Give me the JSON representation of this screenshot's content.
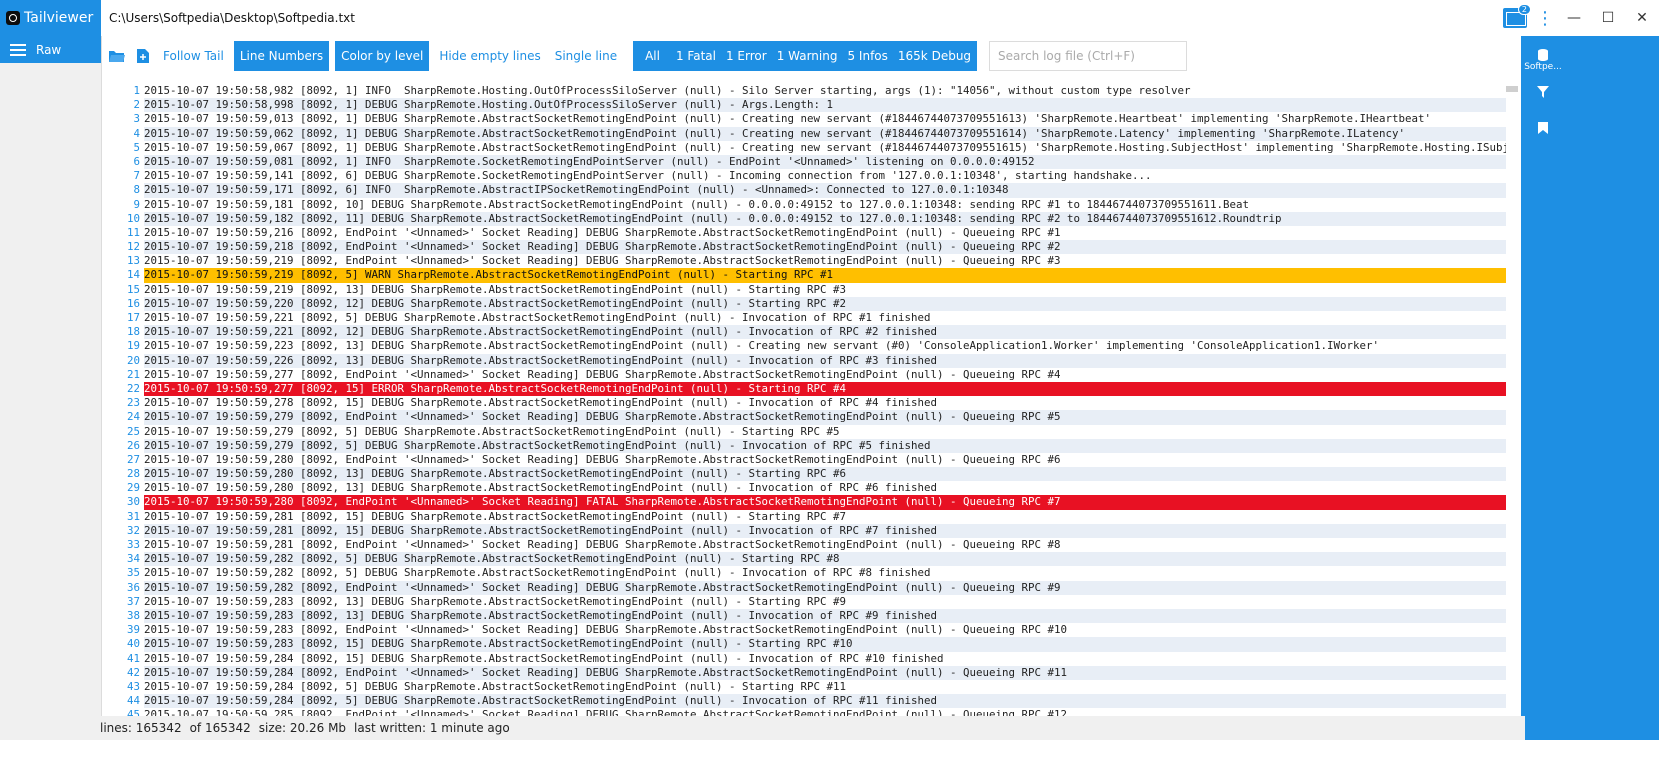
{
  "app": {
    "name": "Tailviewer",
    "file_path": "C:\\Users\\Softpedia\\Desktop\\Softpedia.txt",
    "notification_count": "2"
  },
  "sidebar": {
    "raw_label": "Raw"
  },
  "toolbar": {
    "follow_tail": "Follow Tail",
    "line_numbers": "Line Numbers",
    "color_by_level": "Color by level",
    "hide_empty_lines": "Hide empty lines",
    "single_line": "Single line",
    "levels": {
      "all": "All",
      "fatal": "1 Fatal",
      "error": "1 Error",
      "warning": "1 Warning",
      "infos": "5 Infos",
      "debug": "165k Debug"
    },
    "search_placeholder": "Search log file (Ctrl+F)"
  },
  "right_panel": {
    "datasource_label": "Softpe..."
  },
  "log_lines": [
    {
      "n": "1",
      "text": "2015-10-07 19:50:58,982 [8092, 1] INFO  SharpRemote.Hosting.OutOfProcessSiloServer (null) - Silo Server starting, args (1): \"14056\", without custom type resolver",
      "level": "info"
    },
    {
      "n": "2",
      "text": "2015-10-07 19:50:58,998 [8092, 1] DEBUG SharpRemote.Hosting.OutOfProcessSiloServer (null) - Args.Length: 1",
      "level": "debug"
    },
    {
      "n": "3",
      "text": "2015-10-07 19:50:59,013 [8092, 1] DEBUG SharpRemote.AbstractSocketRemotingEndPoint (null) - Creating new servant (#18446744073709551613) 'SharpRemote.Heartbeat' implementing 'SharpRemote.IHeartbeat'",
      "level": "debug"
    },
    {
      "n": "4",
      "text": "2015-10-07 19:50:59,062 [8092, 1] DEBUG SharpRemote.AbstractSocketRemotingEndPoint (null) - Creating new servant (#18446744073709551614) 'SharpRemote.Latency' implementing 'SharpRemote.ILatency'",
      "level": "debug"
    },
    {
      "n": "5",
      "text": "2015-10-07 19:50:59,067 [8092, 1] DEBUG SharpRemote.AbstractSocketRemotingEndPoint (null) - Creating new servant (#18446744073709551615) 'SharpRemote.Hosting.SubjectHost' implementing 'SharpRemote.Hosting.ISubjectHost'",
      "level": "debug"
    },
    {
      "n": "6",
      "text": "2015-10-07 19:50:59,081 [8092, 1] INFO  SharpRemote.SocketRemotingEndPointServer (null) - EndPoint '<Unnamed>' listening on 0.0.0.0:49152",
      "level": "info"
    },
    {
      "n": "7",
      "text": "2015-10-07 19:50:59,141 [8092, 6] DEBUG SharpRemote.SocketRemotingEndPointServer (null) - Incoming connection from '127.0.0.1:10348', starting handshake...",
      "level": "debug"
    },
    {
      "n": "8",
      "text": "2015-10-07 19:50:59,171 [8092, 6] INFO  SharpRemote.AbstractIPSocketRemotingEndPoint (null) - <Unnamed>: Connected to 127.0.0.1:10348",
      "level": "info"
    },
    {
      "n": "9",
      "text": "2015-10-07 19:50:59,181 [8092, 10] DEBUG SharpRemote.AbstractSocketRemotingEndPoint (null) - 0.0.0.0:49152 to 127.0.0.1:10348: sending RPC #1 to 18446744073709551611.Beat",
      "level": "debug"
    },
    {
      "n": "10",
      "text": "2015-10-07 19:50:59,182 [8092, 11] DEBUG SharpRemote.AbstractSocketRemotingEndPoint (null) - 0.0.0.0:49152 to 127.0.0.1:10348: sending RPC #2 to 18446744073709551612.Roundtrip",
      "level": "debug"
    },
    {
      "n": "11",
      "text": "2015-10-07 19:50:59,216 [8092, EndPoint '<Unnamed>' Socket Reading] DEBUG SharpRemote.AbstractSocketRemotingEndPoint (null) - Queueing RPC #1",
      "level": "debug"
    },
    {
      "n": "12",
      "text": "2015-10-07 19:50:59,218 [8092, EndPoint '<Unnamed>' Socket Reading] DEBUG SharpRemote.AbstractSocketRemotingEndPoint (null) - Queueing RPC #2",
      "level": "debug"
    },
    {
      "n": "13",
      "text": "2015-10-07 19:50:59,219 [8092, EndPoint '<Unnamed>' Socket Reading] DEBUG SharpRemote.AbstractSocketRemotingEndPoint (null) - Queueing RPC #3",
      "level": "debug"
    },
    {
      "n": "14",
      "text": "2015-10-07 19:50:59,219 [8092, 5] WARN SharpRemote.AbstractSocketRemotingEndPoint (null) - Starting RPC #1",
      "level": "warn"
    },
    {
      "n": "15",
      "text": "2015-10-07 19:50:59,219 [8092, 13] DEBUG SharpRemote.AbstractSocketRemotingEndPoint (null) - Starting RPC #3",
      "level": "debug"
    },
    {
      "n": "16",
      "text": "2015-10-07 19:50:59,220 [8092, 12] DEBUG SharpRemote.AbstractSocketRemotingEndPoint (null) - Starting RPC #2",
      "level": "debug"
    },
    {
      "n": "17",
      "text": "2015-10-07 19:50:59,221 [8092, 5] DEBUG SharpRemote.AbstractSocketRemotingEndPoint (null) - Invocation of RPC #1 finished",
      "level": "debug"
    },
    {
      "n": "18",
      "text": "2015-10-07 19:50:59,221 [8092, 12] DEBUG SharpRemote.AbstractSocketRemotingEndPoint (null) - Invocation of RPC #2 finished",
      "level": "debug"
    },
    {
      "n": "19",
      "text": "2015-10-07 19:50:59,223 [8092, 13] DEBUG SharpRemote.AbstractSocketRemotingEndPoint (null) - Creating new servant (#0) 'ConsoleApplication1.Worker' implementing 'ConsoleApplication1.IWorker'",
      "level": "debug"
    },
    {
      "n": "20",
      "text": "2015-10-07 19:50:59,226 [8092, 13] DEBUG SharpRemote.AbstractSocketRemotingEndPoint (null) - Invocation of RPC #3 finished",
      "level": "debug"
    },
    {
      "n": "21",
      "text": "2015-10-07 19:50:59,277 [8092, EndPoint '<Unnamed>' Socket Reading] DEBUG SharpRemote.AbstractSocketRemotingEndPoint (null) - Queueing RPC #4",
      "level": "debug"
    },
    {
      "n": "22",
      "text": "2015-10-07 19:50:59,277 [8092, 15] ERROR SharpRemote.AbstractSocketRemotingEndPoint (null) - Starting RPC #4",
      "level": "error"
    },
    {
      "n": "23",
      "text": "2015-10-07 19:50:59,278 [8092, 15] DEBUG SharpRemote.AbstractSocketRemotingEndPoint (null) - Invocation of RPC #4 finished",
      "level": "debug"
    },
    {
      "n": "24",
      "text": "2015-10-07 19:50:59,279 [8092, EndPoint '<Unnamed>' Socket Reading] DEBUG SharpRemote.AbstractSocketRemotingEndPoint (null) - Queueing RPC #5",
      "level": "debug"
    },
    {
      "n": "25",
      "text": "2015-10-07 19:50:59,279 [8092, 5] DEBUG SharpRemote.AbstractSocketRemotingEndPoint (null) - Starting RPC #5",
      "level": "debug"
    },
    {
      "n": "26",
      "text": "2015-10-07 19:50:59,279 [8092, 5] DEBUG SharpRemote.AbstractSocketRemotingEndPoint (null) - Invocation of RPC #5 finished",
      "level": "debug"
    },
    {
      "n": "27",
      "text": "2015-10-07 19:50:59,280 [8092, EndPoint '<Unnamed>' Socket Reading] DEBUG SharpRemote.AbstractSocketRemotingEndPoint (null) - Queueing RPC #6",
      "level": "debug"
    },
    {
      "n": "28",
      "text": "2015-10-07 19:50:59,280 [8092, 13] DEBUG SharpRemote.AbstractSocketRemotingEndPoint (null) - Starting RPC #6",
      "level": "debug"
    },
    {
      "n": "29",
      "text": "2015-10-07 19:50:59,280 [8092, 13] DEBUG SharpRemote.AbstractSocketRemotingEndPoint (null) - Invocation of RPC #6 finished",
      "level": "debug"
    },
    {
      "n": "30",
      "text": "2015-10-07 19:50:59,280 [8092, EndPoint '<Unnamed>' Socket Reading] FATAL SharpRemote.AbstractSocketRemotingEndPoint (null) - Queueing RPC #7",
      "level": "fatal"
    },
    {
      "n": "31",
      "text": "2015-10-07 19:50:59,281 [8092, 15] DEBUG SharpRemote.AbstractSocketRemotingEndPoint (null) - Starting RPC #7",
      "level": "debug"
    },
    {
      "n": "32",
      "text": "2015-10-07 19:50:59,281 [8092, 15] DEBUG SharpRemote.AbstractSocketRemotingEndPoint (null) - Invocation of RPC #7 finished",
      "level": "debug"
    },
    {
      "n": "33",
      "text": "2015-10-07 19:50:59,281 [8092, EndPoint '<Unnamed>' Socket Reading] DEBUG SharpRemote.AbstractSocketRemotingEndPoint (null) - Queueing RPC #8",
      "level": "debug"
    },
    {
      "n": "34",
      "text": "2015-10-07 19:50:59,282 [8092, 5] DEBUG SharpRemote.AbstractSocketRemotingEndPoint (null) - Starting RPC #8",
      "level": "debug"
    },
    {
      "n": "35",
      "text": "2015-10-07 19:50:59,282 [8092, 5] DEBUG SharpRemote.AbstractSocketRemotingEndPoint (null) - Invocation of RPC #8 finished",
      "level": "debug"
    },
    {
      "n": "36",
      "text": "2015-10-07 19:50:59,282 [8092, EndPoint '<Unnamed>' Socket Reading] DEBUG SharpRemote.AbstractSocketRemotingEndPoint (null) - Queueing RPC #9",
      "level": "debug"
    },
    {
      "n": "37",
      "text": "2015-10-07 19:50:59,283 [8092, 13] DEBUG SharpRemote.AbstractSocketRemotingEndPoint (null) - Starting RPC #9",
      "level": "debug"
    },
    {
      "n": "38",
      "text": "2015-10-07 19:50:59,283 [8092, 13] DEBUG SharpRemote.AbstractSocketRemotingEndPoint (null) - Invocation of RPC #9 finished",
      "level": "debug"
    },
    {
      "n": "39",
      "text": "2015-10-07 19:50:59,283 [8092, EndPoint '<Unnamed>' Socket Reading] DEBUG SharpRemote.AbstractSocketRemotingEndPoint (null) - Queueing RPC #10",
      "level": "debug"
    },
    {
      "n": "40",
      "text": "2015-10-07 19:50:59,283 [8092, 15] DEBUG SharpRemote.AbstractSocketRemotingEndPoint (null) - Starting RPC #10",
      "level": "debug"
    },
    {
      "n": "41",
      "text": "2015-10-07 19:50:59,284 [8092, 15] DEBUG SharpRemote.AbstractSocketRemotingEndPoint (null) - Invocation of RPC #10 finished",
      "level": "debug"
    },
    {
      "n": "42",
      "text": "2015-10-07 19:50:59,284 [8092, EndPoint '<Unnamed>' Socket Reading] DEBUG SharpRemote.AbstractSocketRemotingEndPoint (null) - Queueing RPC #11",
      "level": "debug"
    },
    {
      "n": "43",
      "text": "2015-10-07 19:50:59,284 [8092, 5] DEBUG SharpRemote.AbstractSocketRemotingEndPoint (null) - Starting RPC #11",
      "level": "debug"
    },
    {
      "n": "44",
      "text": "2015-10-07 19:50:59,284 [8092, 5] DEBUG SharpRemote.AbstractSocketRemotingEndPoint (null) - Invocation of RPC #11 finished",
      "level": "debug"
    },
    {
      "n": "45",
      "text": "2015-10-07 19:50:59,285 [8092, EndPoint '<Unnamed>' Socket Reading] DEBUG SharpRemote.AbstractSocketRemotingEndPoint (null) - Queueing RPC #12",
      "level": "debug"
    }
  ],
  "status": {
    "lines": "lines: 165342",
    "of": "of 165342",
    "size": "size: 20.26 Mb",
    "last_written": "last written: 1 minute ago"
  },
  "colors": {
    "accent": "#1e8fe3",
    "warn": "#ffbf00",
    "error": "#e81123",
    "alt_row": "#e8eef6"
  }
}
